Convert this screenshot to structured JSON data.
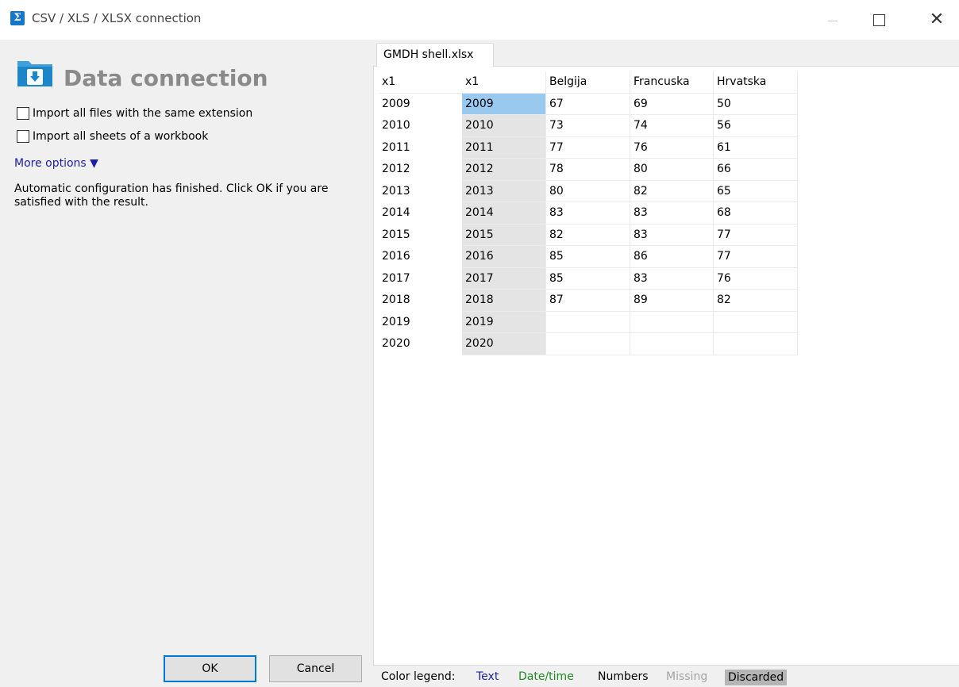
{
  "window": {
    "title": "CSV / XLS / XLSX connection",
    "icon_glyph": "Σ",
    "close_glyph": "✕"
  },
  "left": {
    "title": "Data connection",
    "checkbox1": "Import all files with the same extension",
    "checkbox2": "Import all sheets of a workbook",
    "more_options": "More options ▼",
    "info": "Automatic configuration has finished. Click OK if you are satisfied with the result.",
    "ok": "OK",
    "cancel": "Cancel"
  },
  "tab": {
    "label": "GMDH shell.xlsx"
  },
  "table": {
    "headers": [
      "x1",
      "x1",
      "Belgija",
      "Francuska",
      "Hrvatska"
    ],
    "rows": [
      [
        "2009",
        "2009",
        "67",
        "69",
        "50"
      ],
      [
        "2010",
        "2010",
        "73",
        "74",
        "56"
      ],
      [
        "2011",
        "2011",
        "77",
        "76",
        "61"
      ],
      [
        "2012",
        "2012",
        "78",
        "80",
        "66"
      ],
      [
        "2013",
        "2013",
        "80",
        "82",
        "65"
      ],
      [
        "2014",
        "2014",
        "83",
        "83",
        "68"
      ],
      [
        "2015",
        "2015",
        "82",
        "83",
        "77"
      ],
      [
        "2016",
        "2016",
        "85",
        "86",
        "77"
      ],
      [
        "2017",
        "2017",
        "85",
        "83",
        "76"
      ],
      [
        "2018",
        "2018",
        "87",
        "89",
        "82"
      ],
      [
        "2019",
        "2019",
        "",
        "",
        ""
      ],
      [
        "2020",
        "2020",
        "",
        "",
        ""
      ]
    ]
  },
  "legend": {
    "label": "Color legend:",
    "text": "Text",
    "datetime": "Date/time",
    "numbers": "Numbers",
    "missing": "Missing",
    "discarded": "Discarded"
  },
  "colors": {
    "accent": "#0078d7",
    "text_legend": "#1d1ea6",
    "datetime_legend": "#1d8a22",
    "missing_legend": "#a3a3a3",
    "discarded_bg": "#b5b5b5",
    "selected_cell": "#99c9ef",
    "discarded_cell": "#e4e4e4",
    "title_gray": "#8a8a8a"
  }
}
